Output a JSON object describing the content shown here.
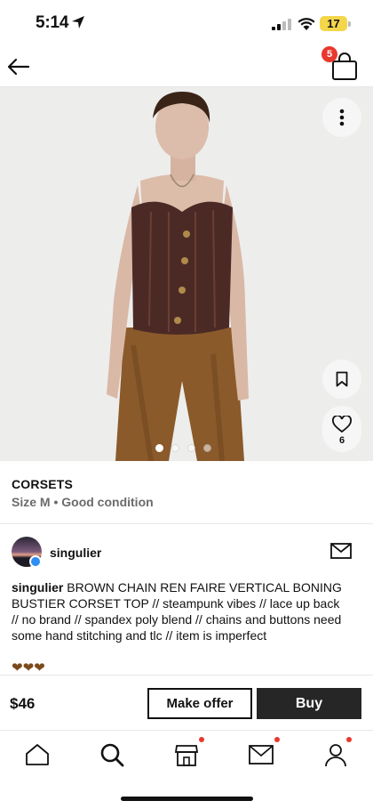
{
  "status_bar": {
    "time": "5:14",
    "battery": "17"
  },
  "nav": {
    "bag_badge": "5"
  },
  "hero": {
    "like_count": "6",
    "carousel_count": 4,
    "carousel_active": 0
  },
  "listing": {
    "title": "CORSETS",
    "subtitle": "Size M • Good condition"
  },
  "seller": {
    "name": "singulier",
    "description_author": "singulier",
    "description": " BROWN CHAIN REN FAIRE VERTICAL BONING BUSTIER CORSET TOP // steampunk vibes // lace up back // no brand // spandex poly blend // chains and buttons need some hand stitching and tlc // item is imperfect",
    "emoji": "❤❤❤"
  },
  "purchase": {
    "price": "$46",
    "offer_label": "Make offer",
    "buy_label": "Buy"
  },
  "tabs": [
    {
      "name": "home-icon"
    },
    {
      "name": "search-icon"
    },
    {
      "name": "shop-icon"
    },
    {
      "name": "mail-icon"
    },
    {
      "name": "profile-icon"
    }
  ],
  "colors": {
    "badge": "#e8392e",
    "buy_button": "#262626",
    "verified": "#2f8ef4"
  }
}
